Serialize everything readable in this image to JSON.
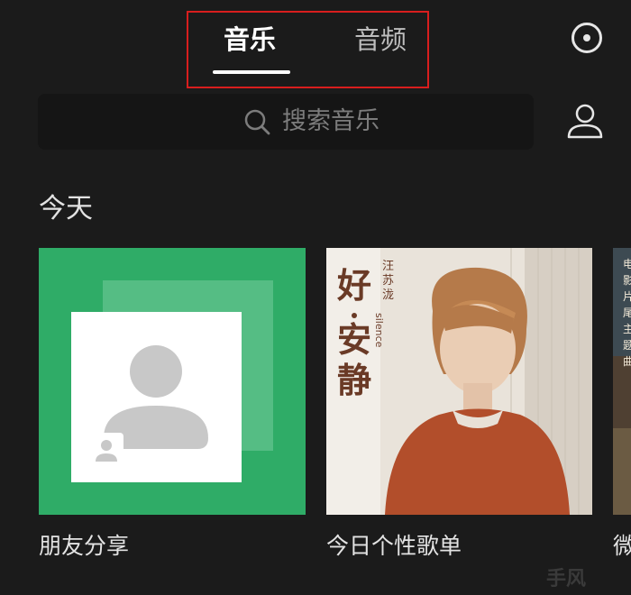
{
  "header": {
    "tabs": [
      {
        "label": "音乐",
        "active": true
      },
      {
        "label": "音频",
        "active": false
      }
    ],
    "highlight_color": "#d81e1e",
    "right_icon": "record-icon"
  },
  "search": {
    "placeholder": "搜索音乐",
    "icon": "search-icon",
    "profile_icon": "user-icon"
  },
  "section": {
    "title": "今天",
    "cards": [
      {
        "label": "朋友分享",
        "cover": "friend-share-cover",
        "color": "#2fac67"
      },
      {
        "label": "今日个性歌单",
        "cover": "album-cover",
        "cover_text": {
          "singer": "汪苏泷",
          "title": "好·安静",
          "subtitle": "silence"
        }
      },
      {
        "label": "微",
        "cover": "partial-cover",
        "cover_text": "电影片尾主题曲"
      }
    ]
  },
  "watermark": "手风"
}
